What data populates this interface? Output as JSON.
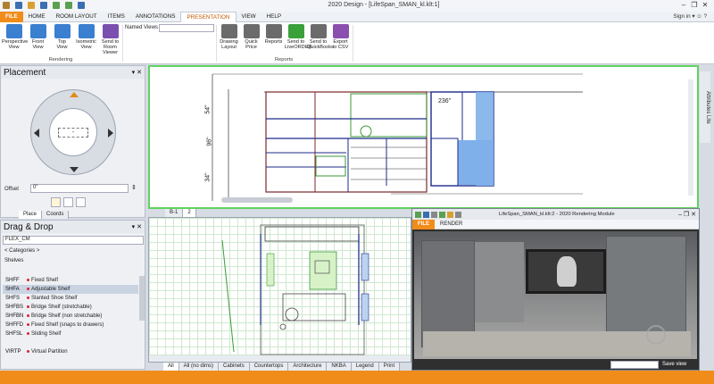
{
  "app": {
    "title": "2020 Design - [LifeSpan_SMAN_kl.klt:1]"
  },
  "tabs": [
    "FILE",
    "HOME",
    "ROOM LAYOUT",
    "ITEMS",
    "ANNOTATIONS",
    "PRESENTATION",
    "VIEW",
    "HELP"
  ],
  "signin": "Sign in",
  "ribbon": {
    "rendering_buttons": [
      {
        "label": "Perspective\nView",
        "icon": "perspective-icon",
        "color": "#3a7fd0"
      },
      {
        "label": "Front\nView",
        "icon": "front-view-icon",
        "color": "#3a7fd0"
      },
      {
        "label": "Top\nView",
        "icon": "top-view-icon",
        "color": "#3a7fd0"
      },
      {
        "label": "Isometric\nView",
        "icon": "isometric-icon",
        "color": "#3a7fd0"
      },
      {
        "label": "Send to\nRoom Viewer",
        "icon": "rv-icon",
        "color": "#7a4fb0"
      }
    ],
    "rendering_group": "Rendering",
    "named_views_label": "Named Views",
    "reports_buttons": [
      {
        "label": "Drawing\nLayout",
        "icon": "drawing-layout-icon",
        "color": "#6b6b6b"
      },
      {
        "label": "Quick\nPrice",
        "icon": "quick-price-icon",
        "color": "#6b6b6b"
      },
      {
        "label": "Reports",
        "icon": "reports-icon",
        "color": "#6b6b6b"
      },
      {
        "label": "Send to\nLiveORDER",
        "icon": "liveorder-icon",
        "color": "#3aa03a"
      },
      {
        "label": "Send to\nQuickBooks",
        "icon": "quickbooks-icon",
        "color": "#6b6b6b"
      },
      {
        "label": "Export\nto CSV",
        "icon": "csv-icon",
        "color": "#8b4fb0"
      }
    ],
    "reports_group": "Reports"
  },
  "placement": {
    "title": "Placement",
    "offset_label": "Offset",
    "offset_value": "0\"",
    "center_value": "-",
    "tabs": [
      "Place",
      "Coords"
    ]
  },
  "dragdrop": {
    "title": "Drag & Drop",
    "catalog": "FLEX_CM",
    "categories": "< Categories >",
    "shelves_heading": "Shelves",
    "items": [
      {
        "code": "SHFF",
        "desc": "Fixed Shelf"
      },
      {
        "code": "SHFA",
        "desc": "Adjustable Shelf"
      },
      {
        "code": "SHFS",
        "desc": "Slanted Shoe Shelf"
      },
      {
        "code": "SHFBS",
        "desc": "Bridge Shelf (stretchable)"
      },
      {
        "code": "SHFBN",
        "desc": "Bridge Shelf (non stretchable)"
      },
      {
        "code": "SHFFD",
        "desc": "Fixed Shelf (snaps to drawers)"
      },
      {
        "code": "SHFSL",
        "desc": "Sliding Shelf"
      },
      {
        "code": "VIRTP",
        "desc": "Virtual Partition"
      }
    ]
  },
  "elevation": {
    "dims": {
      "d1": "54\"",
      "d2": "96\"",
      "d3": "34\"",
      "d4": "236\""
    },
    "tabs": [
      "B-1",
      "2"
    ],
    "side_tab": "Attributes Lite"
  },
  "plan_tabs": [
    "All",
    "All (no dims)",
    "Cabinets",
    "Countertops",
    "Architecture",
    "NKBA",
    "Legend",
    "Print"
  ],
  "render": {
    "title": "LifeSpan_SMAN_kl.klt:2 - 2020 Rendering Module",
    "tabs": [
      "FILE",
      "RENDER"
    ],
    "save_view": "Save view"
  }
}
